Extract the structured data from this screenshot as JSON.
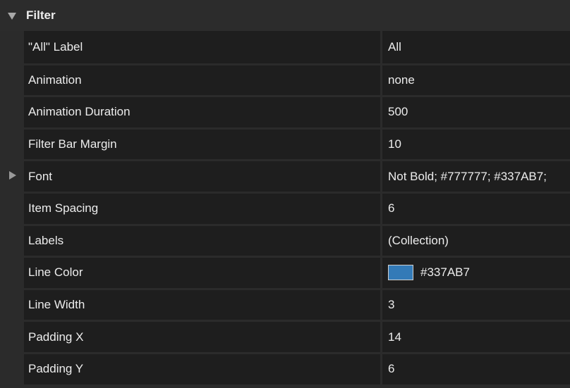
{
  "section": {
    "title": "Filter"
  },
  "rows": [
    {
      "name": "\"All\" Label",
      "value": "All"
    },
    {
      "name": "Animation",
      "value": "none"
    },
    {
      "name": "Animation Duration",
      "value": "500"
    },
    {
      "name": "Filter Bar Margin",
      "value": "10"
    },
    {
      "name": "Font",
      "value": "Not Bold; #777777; #337AB7;"
    },
    {
      "name": "Item Spacing",
      "value": "6"
    },
    {
      "name": "Labels",
      "value": "(Collection)"
    },
    {
      "name": "Line Color",
      "value": "#337AB7",
      "swatch_color": "#337AB7"
    },
    {
      "name": "Line Width",
      "value": "3"
    },
    {
      "name": "Padding X",
      "value": "14"
    },
    {
      "name": "Padding Y",
      "value": "6"
    }
  ]
}
